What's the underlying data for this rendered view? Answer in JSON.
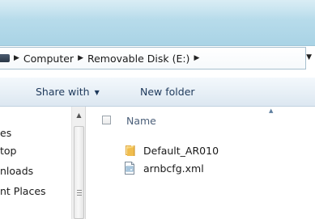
{
  "window": {
    "accent_glass": "#b8dceb"
  },
  "address_bar": {
    "breadcrumb": [
      "Computer",
      "Removable Disk (E:)"
    ],
    "separator_glyph": "▶",
    "dropdown_glyph": "▼",
    "icon": "computer-icon"
  },
  "toolbar": {
    "share_label": "Share with",
    "share_arrow": "▼",
    "new_folder_label": "New folder"
  },
  "nav_pane": {
    "items": [
      {
        "label": "es"
      },
      {
        "label": "top"
      },
      {
        "label": "nloads"
      },
      {
        "label": "nt Places"
      }
    ],
    "scroll_up_glyph": "▲"
  },
  "content": {
    "column_header": "Name",
    "sort_glyph": "▲",
    "files": [
      {
        "name": "Default_AR010",
        "icon": "folder-icon"
      },
      {
        "name": "arnbcfg.xml",
        "icon": "xml-file-icon"
      }
    ]
  }
}
